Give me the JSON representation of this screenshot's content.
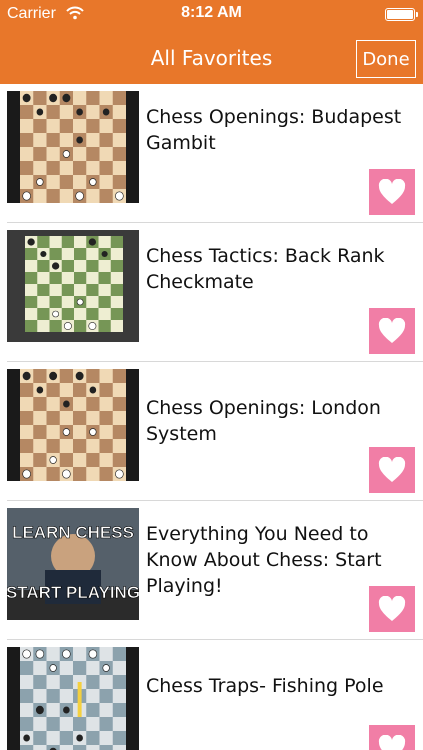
{
  "status": {
    "carrier": "Carrier",
    "time": "8:12 AM"
  },
  "nav": {
    "title": "All Favorites",
    "done_label": "Done"
  },
  "favorites": [
    {
      "title": "Chess Openings: Budapest Gambit",
      "thumb_theme": "brown-board"
    },
    {
      "title": "Chess Tactics: Back Rank Checkmate",
      "thumb_theme": "green-board"
    },
    {
      "title": "Chess Openings: London System",
      "thumb_theme": "brown-board"
    },
    {
      "title": "Everything You Need to Know About Chess: Start Playing!",
      "thumb_theme": "learn-chess",
      "thumb_text_top": "LEARN CHESS",
      "thumb_text_bottom": "START PLAYING"
    },
    {
      "title": "Chess Traps- Fishing Pole",
      "thumb_theme": "blue-board"
    }
  ],
  "colors": {
    "header": "#e8772a",
    "favorite_button": "#f17ea6"
  }
}
